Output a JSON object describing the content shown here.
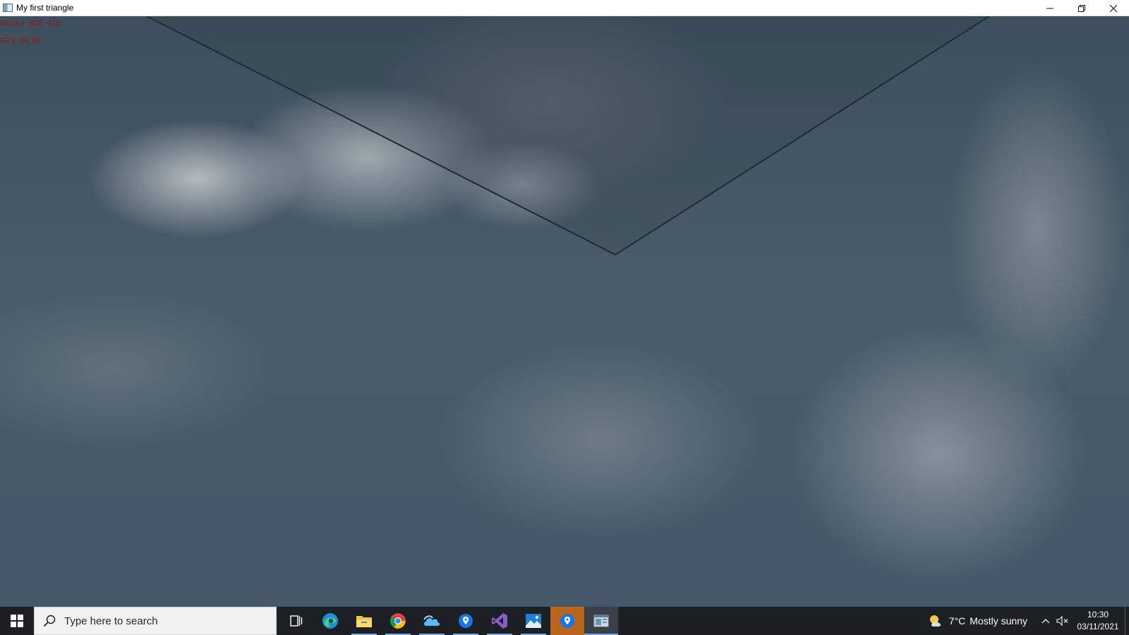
{
  "window": {
    "title": "My first triangle",
    "controls": {
      "minimize_icon": "minimize-icon",
      "restore_icon": "restore-icon",
      "close_icon": "close-icon"
    }
  },
  "scene": {
    "hud": {
      "mouse": "Mouse: 800, 418",
      "fps": "FPS: 96.90"
    },
    "background": "cloudy sky texture",
    "line_color": "#1f2b33",
    "hud_color": "#8b1c1c"
  },
  "taskbar": {
    "start_icon": "windows-start-icon",
    "search": {
      "placeholder": "Type here to search",
      "icon": "search-icon"
    },
    "apps": [
      {
        "name": "task-view-icon",
        "state": "idle"
      },
      {
        "name": "edge-icon",
        "state": "idle"
      },
      {
        "name": "file-explorer-icon",
        "state": "running"
      },
      {
        "name": "chrome-icon",
        "state": "running"
      },
      {
        "name": "cloud-app-icon",
        "state": "running"
      },
      {
        "name": "maps-icon",
        "state": "running"
      },
      {
        "name": "visual-studio-icon",
        "state": "running"
      },
      {
        "name": "photos-icon",
        "state": "running"
      },
      {
        "name": "location-app-icon",
        "state": "active"
      },
      {
        "name": "window-app-icon",
        "state": "focused"
      }
    ],
    "tray": {
      "weather_temp": "7°C",
      "weather_text": "Mostly sunny",
      "weather_icon": "partly-sunny-icon",
      "overflow_icon": "chevron-up-icon",
      "volume_icon": "volume-muted-icon",
      "time": "10:30",
      "date": "03/11/2021"
    }
  }
}
